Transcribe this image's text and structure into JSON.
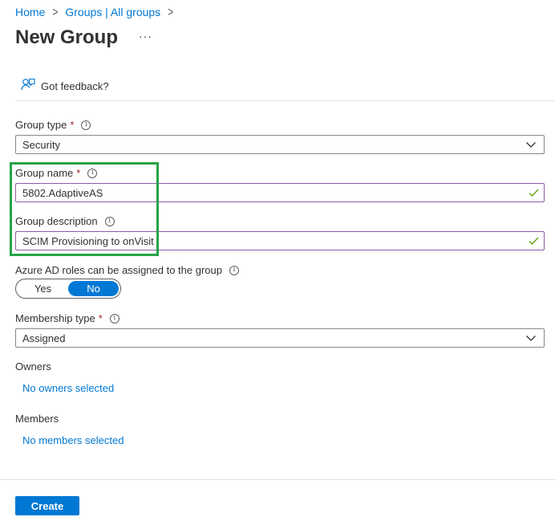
{
  "breadcrumb": {
    "items": [
      "Home",
      "Groups | All groups"
    ]
  },
  "page": {
    "title": "New Group",
    "more": "···"
  },
  "feedback": {
    "label": "Got feedback?"
  },
  "form": {
    "group_type": {
      "label": "Group type",
      "value": "Security"
    },
    "group_name": {
      "label": "Group name",
      "value": "5802.AdaptiveAS"
    },
    "group_description": {
      "label": "Group description",
      "value": "SCIM Provisioning to onVisit"
    },
    "azure_roles": {
      "label": "Azure AD roles can be assigned to the group",
      "yes": "Yes",
      "no": "No",
      "selected": "No"
    },
    "membership_type": {
      "label": "Membership type",
      "value": "Assigned"
    },
    "owners": {
      "label": "Owners",
      "link": "No owners selected"
    },
    "members": {
      "label": "Members",
      "link": "No members selected"
    },
    "required_marker": "*",
    "info_glyph": "i"
  },
  "actions": {
    "create": "Create"
  },
  "colors": {
    "accent": "#0078d4",
    "highlight": "#27a348",
    "valid": "#57a300",
    "required": "#a4262c"
  },
  "icons": [
    "chevron-right-icon",
    "feedback-icon",
    "info-icon",
    "chevron-down-icon",
    "checkmark-icon"
  ]
}
